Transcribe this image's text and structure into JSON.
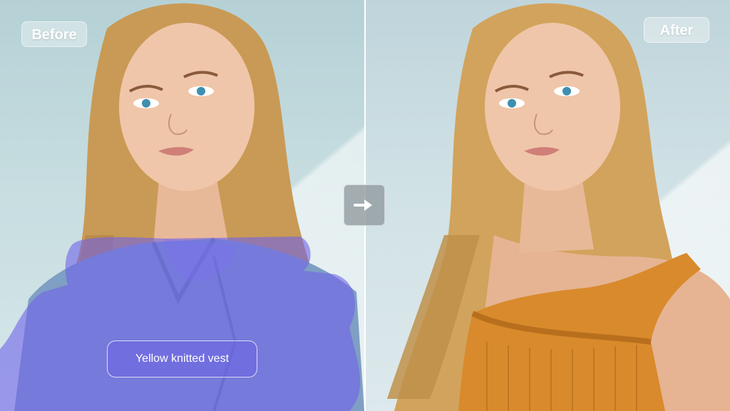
{
  "labels": {
    "before": "Before",
    "after": "After",
    "prompt": "Yellow knitted vest"
  },
  "icons": {
    "transform": "arrow-right-icon"
  },
  "colors": {
    "mask_overlay": "#6f63ea",
    "vest": "#d98a2c",
    "denim_jacket": "#7f9fc4",
    "hair": "#c99a55",
    "skin": "#efc6a9",
    "background_wall": "#c9dde1"
  }
}
